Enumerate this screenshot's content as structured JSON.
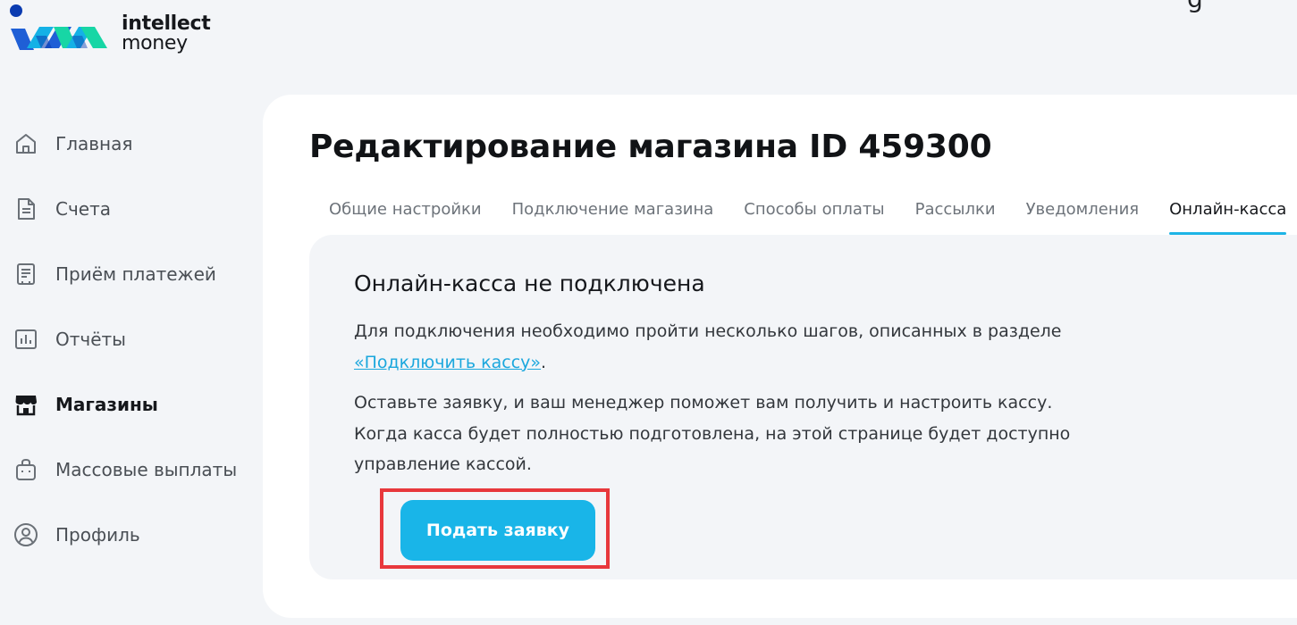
{
  "logo": {
    "line1": "intellect",
    "line2": "money",
    "colors": [
      "#1f5fd6",
      "#14b1e6",
      "#17d6a5",
      "#0b3bb0"
    ]
  },
  "corner_glyph": "g",
  "sidebar": {
    "items": [
      {
        "label": "Главная",
        "icon": "home-icon",
        "active": false
      },
      {
        "label": "Счета",
        "icon": "document-icon",
        "active": false
      },
      {
        "label": "Приём платежей",
        "icon": "payment-terminal-icon",
        "active": false
      },
      {
        "label": "Отчёты",
        "icon": "bar-chart-icon",
        "active": false
      },
      {
        "label": "Магазины",
        "icon": "store-icon",
        "active": true
      },
      {
        "label": "Массовые выплаты",
        "icon": "bag-icon",
        "active": false
      },
      {
        "label": "Профиль",
        "icon": "user-circle-icon",
        "active": false
      }
    ]
  },
  "main": {
    "title": "Редактирование магазина ID 459300",
    "tabs": [
      {
        "label": "Общие настройки",
        "active": false
      },
      {
        "label": "Подключение магазина",
        "active": false
      },
      {
        "label": "Способы оплаты",
        "active": false
      },
      {
        "label": "Рассылки",
        "active": false
      },
      {
        "label": "Уведомления",
        "active": false
      },
      {
        "label": "Онлайн-касса",
        "active": true
      }
    ],
    "panel": {
      "title": "Онлайн-касса не подключена",
      "p1_text": "Для подключения необходимо пройти несколько шагов, описанных в разделе",
      "p1_link": "«Подключить кассу»",
      "p1_end": ".",
      "p2_line1": "Оставьте заявку, и ваш менеджер поможет вам получить и настроить кассу.",
      "p2_line2": "Когда касса будет полностью подготовлена, на этой странице будет доступно",
      "p2_line3": "управление кассой.",
      "button_label": "Подать заявку"
    }
  },
  "colors": {
    "accent": "#19b5e8",
    "link": "#1ba7dd",
    "highlight": "#e8383c",
    "background": "#f3f5f8",
    "card": "#ffffff"
  }
}
